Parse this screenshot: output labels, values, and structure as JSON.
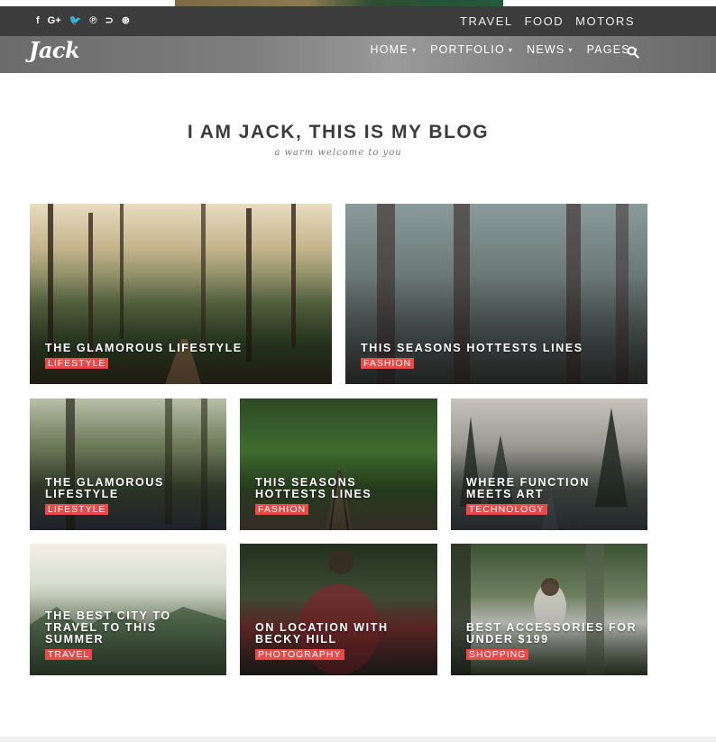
{
  "topbar": {
    "social": [
      {
        "name": "facebook-icon",
        "glyph": "f"
      },
      {
        "name": "google-plus-icon",
        "glyph": "G+"
      },
      {
        "name": "twitter-icon",
        "glyph": "🐦"
      },
      {
        "name": "pinterest-icon",
        "glyph": "℗"
      },
      {
        "name": "rss-icon",
        "glyph": "⊃"
      },
      {
        "name": "dribbble-icon",
        "glyph": "⊛"
      }
    ],
    "links": [
      "TRAVEL",
      "FOOD",
      "MOTORS"
    ]
  },
  "header": {
    "logo": "Jack",
    "nav": [
      "HOME",
      "PORTFOLIO",
      "NEWS",
      "PAGES"
    ],
    "search_icon": "search-icon"
  },
  "hero": {
    "title": "I AM JACK, THIS IS MY BLOG",
    "subtitle": "a warm welcome to you"
  },
  "cards": [
    {
      "title": "THE GLAMOROUS LIFESTYLE",
      "tag": "LIFESTYLE"
    },
    {
      "title": "THIS SEASONS HOTTESTS LINES",
      "tag": "FASHION"
    },
    {
      "title": "THE GLAMOROUS LIFESTYLE",
      "tag": "LIFESTYLE"
    },
    {
      "title": "THIS SEASONS HOTTESTS LINES",
      "tag": "FASHION"
    },
    {
      "title": "WHERE FUNCTION MEETS ART",
      "tag": "TECHNOLOGY"
    },
    {
      "title": "THE BEST CITY TO TRAVEL TO THIS SUMMER",
      "tag": "TRAVEL"
    },
    {
      "title": "ON LOCATION WITH BECKY HILL",
      "tag": "PHOTOGRAPHY"
    },
    {
      "title": "BEST ACCESSORIES FOR UNDER $199",
      "tag": "SHOPPING"
    }
  ],
  "colors": {
    "topbar_bg": "#3c3c3c",
    "tag_red": "#e84a4a",
    "title_dark": "#3b3b3b"
  }
}
